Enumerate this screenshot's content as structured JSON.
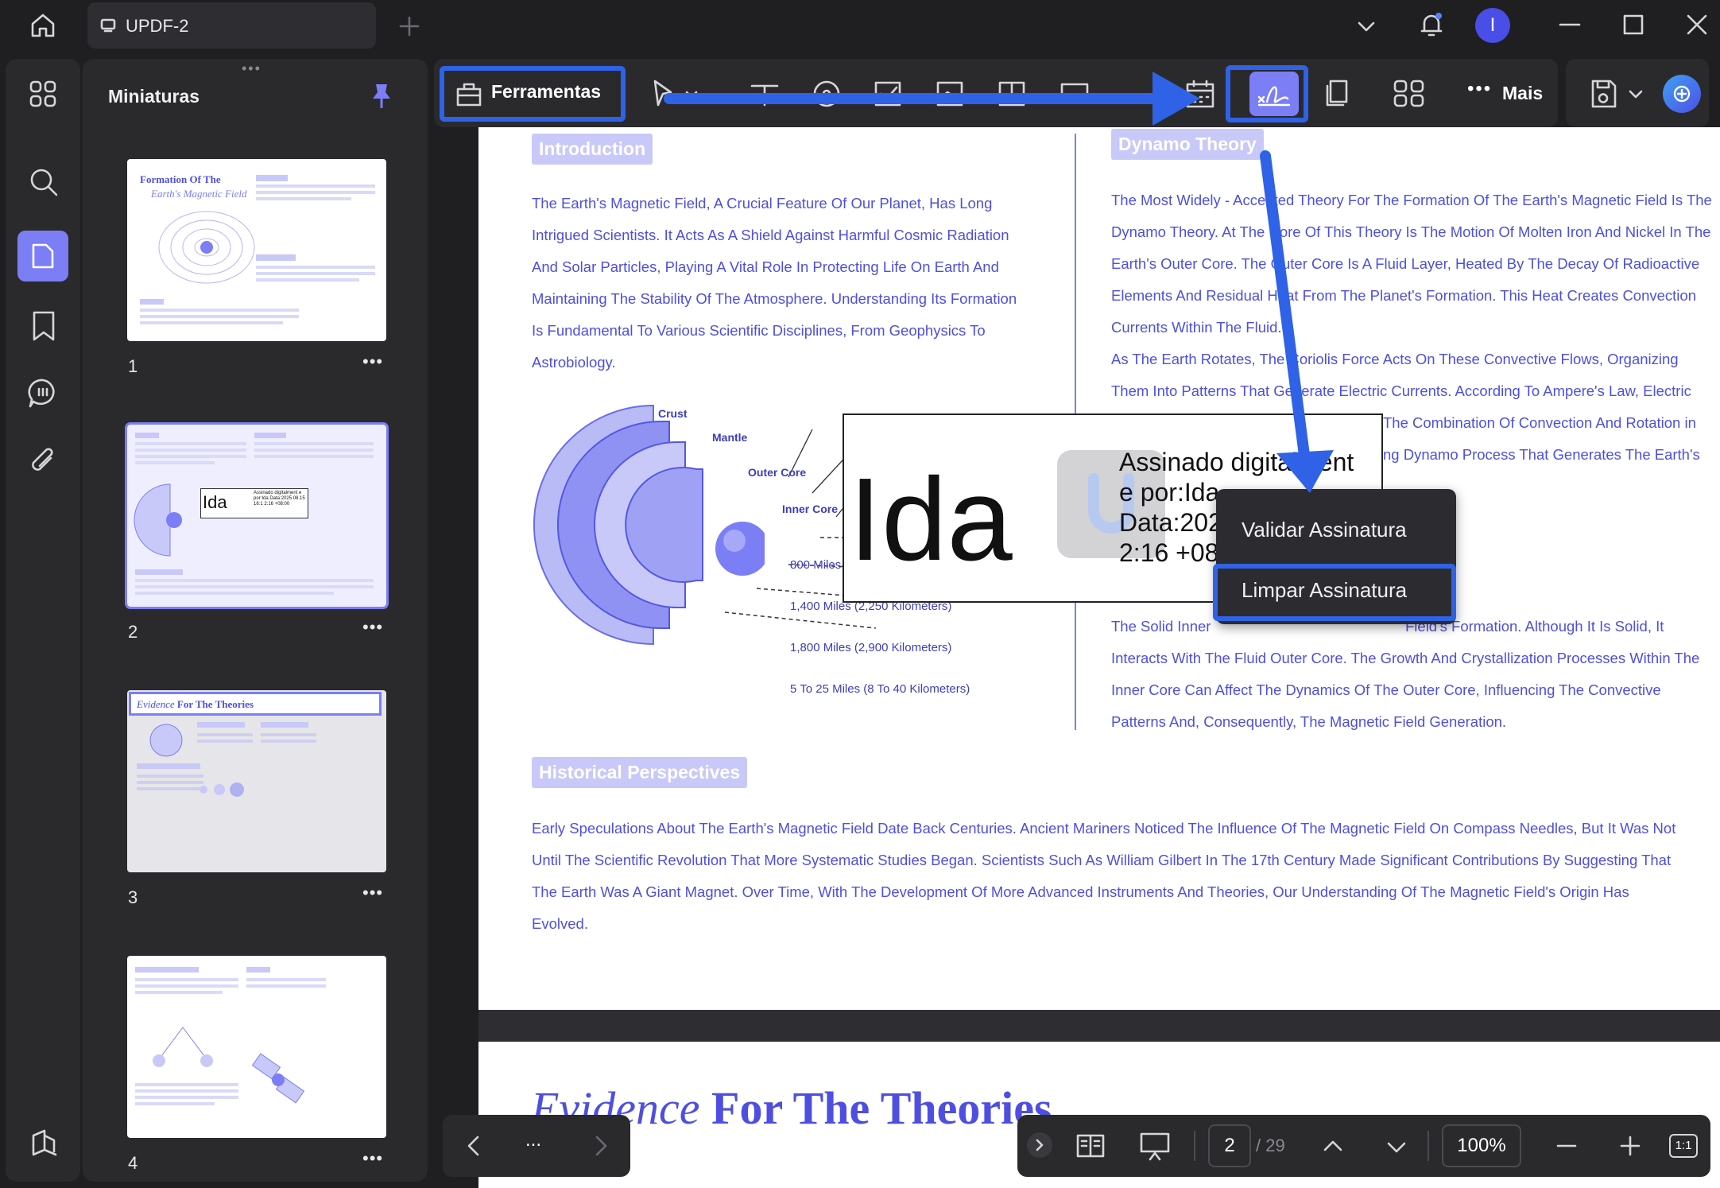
{
  "window": {
    "tab_title": "UPDF-2",
    "avatar_letter": "I"
  },
  "sidebar": {
    "panel_title": "Miniaturas",
    "thumbnails": [
      {
        "page": "1",
        "title_line1": "Formation Of The",
        "title_line2": "Earth's Magnetic Field"
      },
      {
        "page": "2",
        "sig_name": "Ida",
        "sig_text": "Assinado digitalment e por:Ida Data:2025.08.15 16:1 2:16 +08:00"
      },
      {
        "page": "3",
        "title_italic": "Evidence",
        "title_rest": " For The Theories"
      },
      {
        "page": "4"
      }
    ]
  },
  "toolbar": {
    "tools_label": "Ferramentas",
    "more_label": "Mais"
  },
  "document": {
    "intro_heading": "Introduction",
    "intro_text": "The Earth's Magnetic Field, A Crucial Feature Of Our Planet, Has Long Intrigued Scientists. It Acts As A Shield Against Harmful Cosmic Radiation And Solar Particles, Playing A Vital Role In Protecting Life On Earth And Maintaining The Stability Of The Atmosphere. Understanding Its Formation Is Fundamental To Various Scientific Disciplines, From Geophysics To Astrobiology.",
    "dynamo_heading": "Dynamo Theory",
    "dynamo_text_1": "The Most Widely - Accepted Theory For The Formation Of The Earth's Magnetic Field Is The Dynamo Theory. At The Core Of This Theory Is The Motion Of Molten Iron And Nickel In The Earth's Outer Core. The Outer Core Is A Fluid Layer, Heated By The Decay Of Radioactive Elements And Residual Heat From The Planet's Formation. This Heat Creates Convection Currents Within The Fluid.",
    "dynamo_text_2": "As The Earth Rotates, The Coriolis Force Acts On These Convective Flows, Organizing Them Into Patterns That Generate Electric Currents. According To Ampere's Law, Electric",
    "dynamo_text_2b": "The Combination Of Convection And Rotation in",
    "dynamo_text_2c": "ng Dynamo Process That Generates The Earth's",
    "dynamo_text_3": "The Solid Inner",
    "dynamo_text_3b": "Field's Formation. Although It Is Solid, It Interacts With The Fluid Outer Core. The Growth And Crystallization Processes Within The Inner Core Can Affect The Dynamics Of The Outer Core, Influencing The Convective Patterns And, Consequently, The Magnetic Field Generation.",
    "diagram_labels": {
      "crust": "Crust",
      "mantle": "Mantle",
      "outer_core": "Outer Core",
      "inner_core": "Inner Core",
      "d1": "800 Miles",
      "d2": "1,400 Miles (2,250 Kilometers)",
      "d3": "1,800 Miles (2,900 Kilometers)",
      "d4": "5 To 25 Miles (8 To 40 Kilometers)"
    },
    "historical_heading": "Historical Perspectives",
    "historical_text": "Early Speculations About The Earth's Magnetic Field Date Back Centuries. Ancient Mariners Noticed The Influence Of The Magnetic Field On Compass Needles, But It Was Not Until The Scientific Revolution That More Systematic Studies Began. Scientists Such As William Gilbert In The 17th Century Made Significant Contributions By Suggesting That The Earth Was A Giant Magnet. Over Time, With The Development Of More Advanced Instruments And Theories, Our Understanding Of The Magnetic Field's Origin Has Evolved.",
    "next_page_italic": "Evidence",
    "next_page_rest": " For The Theories"
  },
  "signature": {
    "name": "Ida",
    "line1": "Assinado digitalment",
    "line2": "e por:Ida",
    "line3": "Data:202",
    "line4": "2:16 +08"
  },
  "context_menu": {
    "validate": "Validar Assinatura",
    "clear": "Limpar Assinatura"
  },
  "bottom_nav": {
    "ellipsis": "..."
  },
  "page_nav": {
    "current_page": "2",
    "total_pages": "/ 29",
    "zoom": "100%",
    "fit_label": "1:1"
  },
  "colors": {
    "accent": "#7b7ef5",
    "highlight_blue": "#2f62e6",
    "doc_text": "#4e4fe0",
    "heading_bg": "#c8c9f8"
  }
}
